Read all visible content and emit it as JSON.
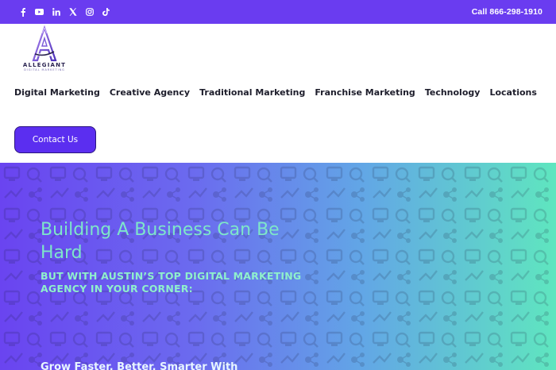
{
  "topbar": {
    "socials": [
      {
        "name": "facebook-icon"
      },
      {
        "name": "youtube-icon"
      },
      {
        "name": "linkedin-icon"
      },
      {
        "name": "x-twitter-icon"
      },
      {
        "name": "instagram-icon"
      },
      {
        "name": "tiktok-icon"
      }
    ],
    "call_text": "Call 866-298-1910"
  },
  "header": {
    "logo": {
      "name": "ALLEGIANT",
      "tagline": "DIGITAL MARKETING"
    },
    "nav": [
      {
        "label": "Digital Marketing"
      },
      {
        "label": "Creative Agency"
      },
      {
        "label": "Traditional Marketing"
      },
      {
        "label": "Franchise Marketing"
      },
      {
        "label": "Technology"
      },
      {
        "label": "Locations"
      }
    ],
    "contact_label": "Contact Us"
  },
  "hero": {
    "title": "Building A Business Can Be Hard",
    "subtitle": "BUT WITH AUSTIN’S TOP DIGITAL MARKETING AGENCY IN YOUR CORNER:",
    "partial_line": "Grow Faster, Better, Smarter With"
  },
  "colors": {
    "topbar_bg": "#6a3cf0",
    "button_bg": "#5b2ef0",
    "hero_gradient_start": "#6a44f0",
    "hero_gradient_end": "#5fe6bf",
    "hero_text": "#7ee6c9"
  }
}
